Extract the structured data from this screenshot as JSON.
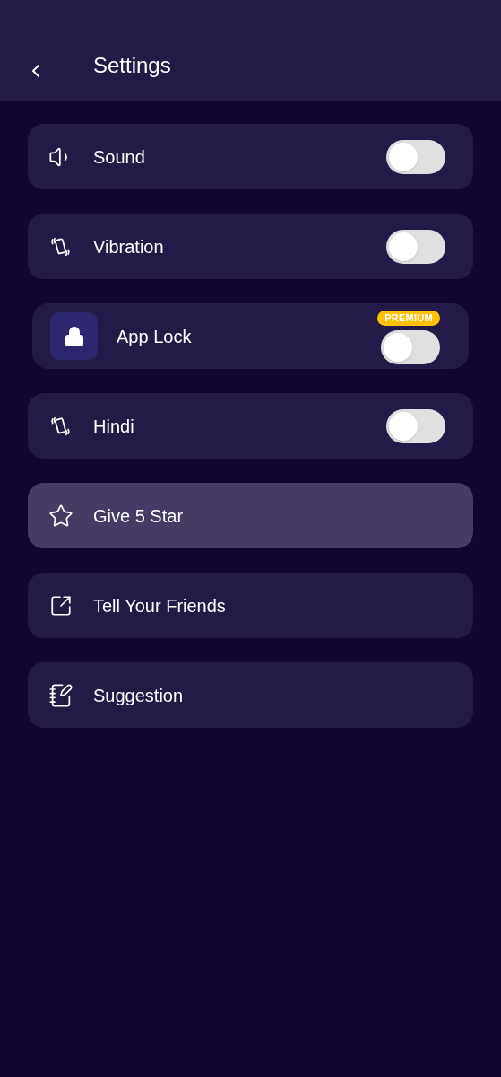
{
  "header": {
    "title": "Settings"
  },
  "items": [
    {
      "kind": "toggle",
      "label": "Sound",
      "on": false,
      "selected": false
    },
    {
      "kind": "toggle",
      "label": "Vibration",
      "on": false,
      "selected": false
    },
    {
      "kind": "premium_toggle",
      "label": "App Lock",
      "badge": "PREMIUM",
      "on": false,
      "selected": false
    },
    {
      "kind": "toggle",
      "label": "Hindi",
      "on": false,
      "selected": false
    },
    {
      "kind": "link",
      "label": "Give 5 Star",
      "selected": true
    },
    {
      "kind": "link",
      "label": "Tell Your Friends",
      "selected": false
    },
    {
      "kind": "link",
      "label": "Suggestion",
      "selected": false
    }
  ]
}
